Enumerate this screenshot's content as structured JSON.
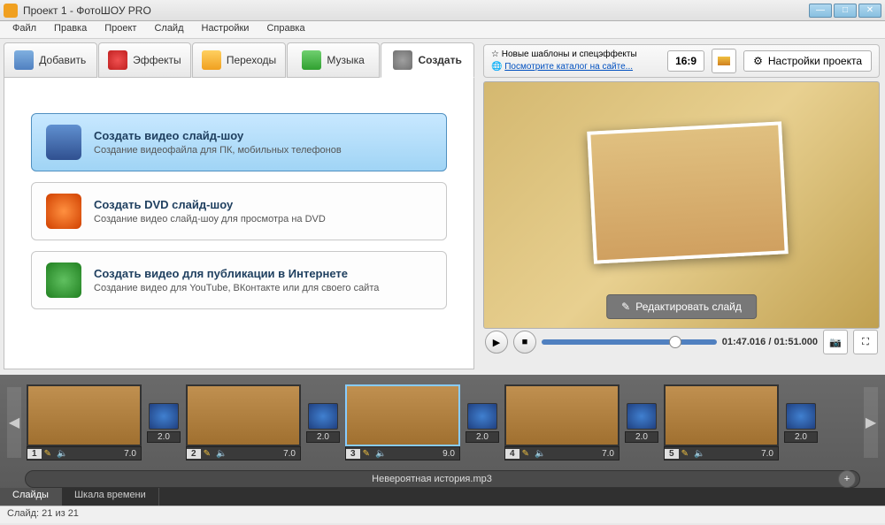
{
  "window": {
    "title": "Проект 1 - ФотоШОУ PRO"
  },
  "menu": [
    "Файл",
    "Правка",
    "Проект",
    "Слайд",
    "Настройки",
    "Справка"
  ],
  "tabs": {
    "add": "Добавить",
    "effects": "Эффекты",
    "transitions": "Переходы",
    "music": "Музыка",
    "create": "Создать"
  },
  "options": {
    "video": {
      "title": "Создать видео слайд-шоу",
      "desc": "Создание видеофайла для ПК, мобильных телефонов"
    },
    "dvd": {
      "title": "Создать DVD слайд-шоу",
      "desc": "Создание видео слайд-шоу для просмотра на DVD"
    },
    "web": {
      "title": "Создать видео для публикации в Интернете",
      "desc": "Создание видео для YouTube, ВКонтакте или для своего сайта"
    }
  },
  "info": {
    "line1": "Новые шаблоны и спецэффекты",
    "line2": "Посмотрите каталог на сайте..."
  },
  "aspect": "16:9",
  "settings_label": "Настройки проекта",
  "edit_slide": "Редактировать слайд",
  "time": "01:47.016 / 01:51.000",
  "slides": [
    {
      "num": "1",
      "dur": "7.0",
      "trans": "2.0"
    },
    {
      "num": "2",
      "dur": "7.0",
      "trans": "2.0"
    },
    {
      "num": "3",
      "dur": "9.0",
      "trans": "2.0"
    },
    {
      "num": "4",
      "dur": "7.0",
      "trans": "2.0"
    },
    {
      "num": "5",
      "dur": "7.0",
      "trans": "2.0"
    }
  ],
  "audio": "Невероятная история.mp3",
  "view": {
    "slides": "Слайды",
    "timeline": "Шкала времени"
  },
  "status": "Слайд: 21 из 21"
}
